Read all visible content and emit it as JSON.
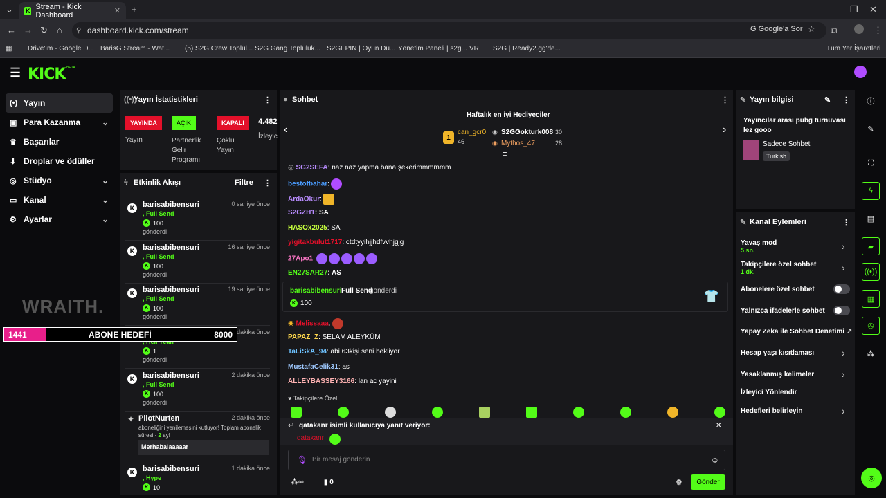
{
  "browser": {
    "tab_title": "Stream - Kick Dashboard",
    "url": "dashboard.kick.com/stream",
    "google_btn": "Google'a Sor",
    "bookmarks": [
      "Drive'ım - Google D...",
      "BarisG Stream - Wat...",
      "(5) S2G Crew Toplul...",
      "S2G Gang Topluluk...",
      "S2GEPIN | Oyun Dü...",
      "Yönetim Paneli | s2g...",
      "VR",
      "S2G | Ready2.gg'de..."
    ],
    "all_bookmarks": "Tüm Yer İşaretleri"
  },
  "header": {
    "logo": "KICK",
    "beta": "BETA"
  },
  "sidebar": {
    "items": [
      {
        "label": "Yayın",
        "icon": "(•)"
      },
      {
        "label": "Para Kazanma",
        "icon": "▣"
      },
      {
        "label": "Başarılar",
        "icon": "🏆"
      },
      {
        "label": "Droplar ve ödüller",
        "icon": "⬇"
      },
      {
        "label": "Stüdyo",
        "icon": "◎"
      },
      {
        "label": "Kanal",
        "icon": "▭"
      },
      {
        "label": "Ayarlar",
        "icon": "⚙"
      }
    ],
    "watermark": "WRAITH."
  },
  "overlay": {
    "current": "1441",
    "label": "ABONE HEDEFİ",
    "target": "8000",
    "progress": 0.18
  },
  "stats": {
    "title": "Yayın İstatistikleri",
    "live_badge": "YAYINDA",
    "live_label": "Yayın",
    "partner_badge": "AÇIK",
    "partner_label": "Partnerlik Gelir Programı",
    "multi_badge": "KAPALI",
    "multi_label": "Çoklu Yayın",
    "viewers": "4.482",
    "viewers_label": "İzleyic"
  },
  "activity": {
    "title": "Etkinlik Akışı",
    "filter": "Filtre",
    "events": [
      {
        "name": "barisabibensuri",
        "time": "0 saniye önce",
        "item": ", Full Send",
        "amount": "100",
        "sent": "gönderdi"
      },
      {
        "name": "barisabibensuri",
        "time": "16 saniye önce",
        "item": ", Full Send",
        "amount": "100",
        "sent": "gönderdi"
      },
      {
        "name": "barisabibensuri",
        "time": "19 saniye önce",
        "item": ", Full Send",
        "amount": "100",
        "sent": "gönderdi"
      },
      {
        "name": "barisabibensuri",
        "time": "1 dakika önce",
        "item": ", Hell Yeah",
        "amount": "1",
        "sent": "gönderdi"
      },
      {
        "name": "barisabibensuri",
        "time": "2 dakika önce",
        "item": ", Full Send",
        "amount": "100",
        "sent": "gönderdi"
      }
    ],
    "resub": {
      "name": "PilotNurten",
      "time": "2 dakika önce",
      "text": "aboneliğini yenilemesini kutluyor! Toplam abonelik süresi - ",
      "months": "2",
      "months_suffix": " ay!",
      "message": "Merhabalaaaaar"
    },
    "last": {
      "name": "barisabibensuri",
      "time": "1 dakika önce",
      "item": ", Hype",
      "amount": "10"
    }
  },
  "chat": {
    "title": "Sohbet",
    "gifters_title": "Haftalık en iyi Hediyeciler",
    "gifters": [
      {
        "rank": "1",
        "name": "can_gcr0",
        "count": "46"
      },
      {
        "name": "S2GGokturk008",
        "count": "30"
      },
      {
        "name": "Mythos_47",
        "count": "28"
      }
    ],
    "messages": [
      {
        "user": "SG2SEFA",
        "text": ": naz naz yapma bana şekerimmmmmm",
        "color": "#b98cff"
      },
      {
        "user": "bestofbahar",
        "text": ":",
        "color": "#4a9cff"
      },
      {
        "user": "ArdaOkur",
        "text": ":",
        "color": "#b98cff"
      },
      {
        "user": "S2GZH1",
        "text": ": SA",
        "color": "#b98cff"
      },
      {
        "user": "HASOx2025",
        "text": ": SA",
        "color": "#c6ff3d"
      },
      {
        "user": "yigitakbulut1717",
        "text": ": ctdtyyihjjhdfvvhjgjg",
        "color": "#e3102a"
      },
      {
        "user": "27Apo1",
        "text": ":",
        "color": "#ff77c8"
      },
      {
        "user": "EN27SAR27",
        "text": ": AS",
        "color": "#53fc18"
      },
      {
        "user": "Melissaaa",
        "text": ":",
        "color": "#e3102a"
      },
      {
        "user": "PAPAZ_Z",
        "text": ": SELAM ALEYKÜM",
        "color": "#ffd84d"
      },
      {
        "user": "TaLiSkA_94",
        "text": ": abi 63kişi seni bekliyor",
        "color": "#6ec2ff"
      },
      {
        "user": "MustafaCelik31",
        "text": ": as",
        "color": "#9fc9ff"
      },
      {
        "user": "ALLEYBASSEY3166",
        "text": ": lan ac yayini",
        "color": "#ffb3b3"
      }
    ],
    "gift_msg": {
      "user": "barisabibensuri",
      "item": "Full Send",
      "verb": "gönderdi",
      "amount": "100"
    },
    "followers_only": "Takipçilere Özel",
    "reply_to": "qatakanr isimli kullanıcıya yanıt veriyor:",
    "reply_user": "qatakanr",
    "placeholder": "Bir mesaj gönderin",
    "count": "0",
    "send": "Gönder"
  },
  "stream_info": {
    "title": "Yayın bilgisi",
    "stream_title": "Yayıncılar arası pubg turnuvası lez gooo",
    "category": "Sadece Sohbet",
    "tag": "Turkish"
  },
  "channel_actions": {
    "title": "Kanal Eylemleri",
    "items": [
      {
        "label": "Yavaş mod",
        "sub": "5 sn."
      },
      {
        "label": "Takipçilere özel sohbet",
        "sub": "1 dk."
      },
      {
        "label": "Abonelere özel sohbet"
      },
      {
        "label": "Yalnızca ifadelerle sohbet"
      },
      {
        "label": "Yapay Zeka ile Sohbet Denetimi"
      },
      {
        "label": "Hesap yaşı kısıtlaması"
      },
      {
        "label": "Yasaklanmış kelimeler"
      },
      {
        "label": "İzleyici Yönlendir"
      },
      {
        "label": "Hedefleri belirleyin"
      }
    ]
  }
}
